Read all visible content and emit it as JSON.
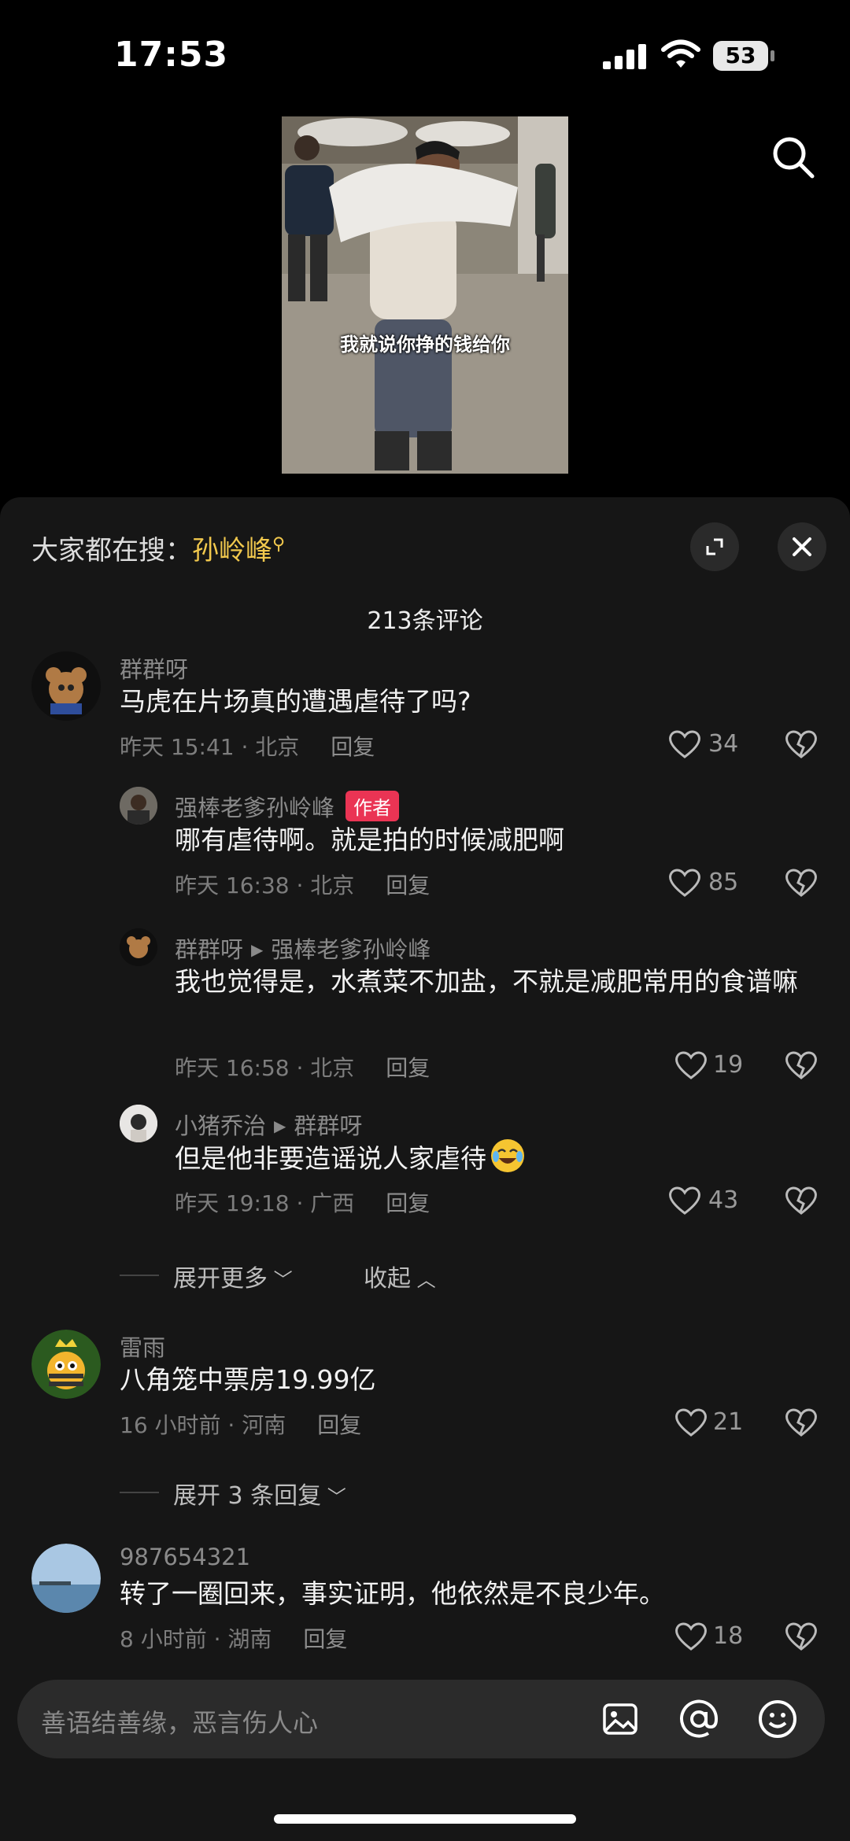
{
  "status": {
    "time": "17:53",
    "battery": "53"
  },
  "video": {
    "subtitle": "我就说你挣的钱给你"
  },
  "panel": {
    "trending_prefix": "大家都在搜：",
    "trending_keyword": "孙岭峰",
    "comment_count": "213条评论"
  },
  "comments": [
    {
      "user": "群群呀",
      "text": "马虎在片场真的遭遇虐待了吗?",
      "meta": "昨天 15:41 · 北京",
      "reply": "回复",
      "likes": "34"
    },
    {
      "user": "强棒老爹孙岭峰",
      "badge": "作者",
      "text": "哪有虐待啊。就是拍的时候减肥啊",
      "meta": "昨天 16:38 · 北京",
      "reply": "回复",
      "likes": "85"
    },
    {
      "user": "群群呀",
      "reply_to": "强棒老爹孙岭峰",
      "text": "我也觉得是，水煮菜不加盐，不就是减肥常用的食谱嘛",
      "meta": "昨天 16:58 · 北京",
      "reply": "回复",
      "likes": "19"
    },
    {
      "user": "小猪乔治",
      "reply_to": "群群呀",
      "text": "但是他非要造谣说人家虐待",
      "meta": "昨天 19:18 · 广西",
      "reply": "回复",
      "likes": "43"
    },
    {
      "user": "雷雨",
      "text": "八角笼中票房19.99亿",
      "meta": "16 小时前 · 河南",
      "reply": "回复",
      "likes": "21"
    },
    {
      "user": "987654321",
      "text": "转了一圈回来，事实证明，他依然是不良少年。",
      "meta": "8 小时前 · 湖南",
      "reply": "回复",
      "likes": "18"
    }
  ],
  "expand_more": "展开更多",
  "collapse": "收起",
  "expand_replies": "展开 3 条回复",
  "input": {
    "placeholder": "善语结善缘，恶言伤人心"
  },
  "icons": {
    "search": "search-icon",
    "expand": "expand-icon",
    "close": "close-icon",
    "like": "heart-icon",
    "dislike": "broken-heart-icon",
    "image": "image-icon",
    "mention": "at-icon",
    "emoji": "emoji-icon"
  },
  "colors": {
    "keyword": "#f1c84d",
    "author_badge": "#ea3454",
    "panel_bg": "#161616"
  }
}
